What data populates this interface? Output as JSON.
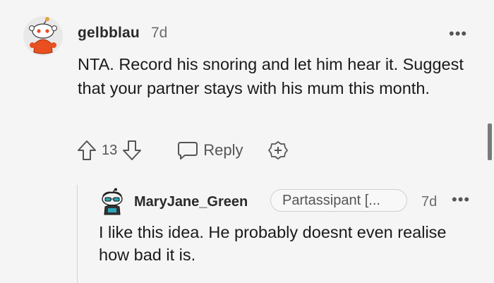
{
  "comment": {
    "author": "gelbblau",
    "age": "7d",
    "more_label": "•••",
    "text": "NTA. Record his snoring and let him hear it. Suggest that your partner stays with his mum this month.",
    "score": "13",
    "reply_label": "Reply",
    "avatar_icon": "snoo-avatar-icon",
    "award_icon": "add-award-icon"
  },
  "reply": {
    "author": "MaryJane_Green",
    "flair": "Partassipant [...",
    "age": "7d",
    "more_label": "•••",
    "text": "I like this idea. He probably doesnt even realise how bad it is.",
    "avatar_icon": "snoo-avatar-icon"
  },
  "colors": {
    "background": "#f5f5f5",
    "text_primary": "#1a1a1a",
    "text_muted": "#6b6b6b",
    "avatar_orange": "#e8501f"
  }
}
